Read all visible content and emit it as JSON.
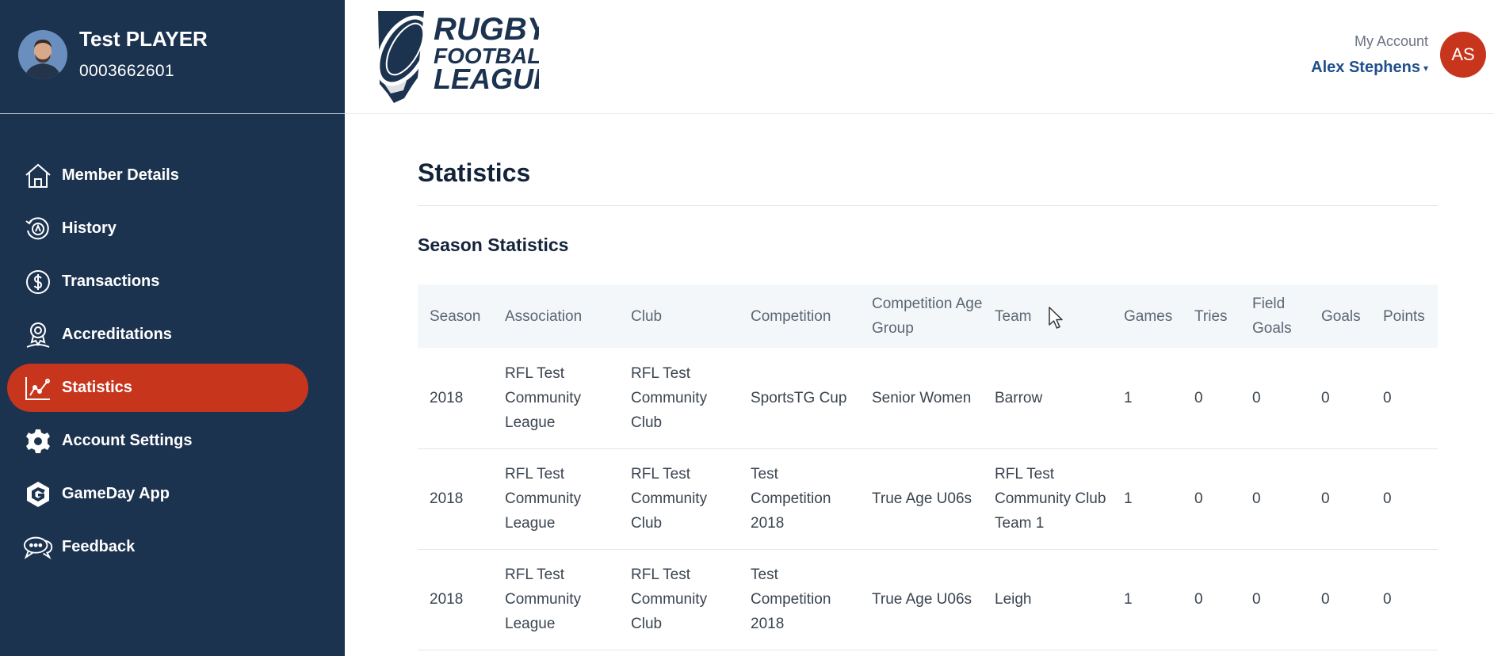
{
  "profile": {
    "name": "Test PLAYER",
    "member_id": "0003662601"
  },
  "nav": {
    "items": [
      {
        "label": "Member Details",
        "icon": "home-icon"
      },
      {
        "label": "History",
        "icon": "history-icon"
      },
      {
        "label": "Transactions",
        "icon": "dollar-icon"
      },
      {
        "label": "Accreditations",
        "icon": "accreditation-icon"
      },
      {
        "label": "Statistics",
        "icon": "chart-icon",
        "active": true
      },
      {
        "label": "Account Settings",
        "icon": "gear-icon"
      },
      {
        "label": "GameDay App",
        "icon": "gameday-icon"
      },
      {
        "label": "Feedback",
        "icon": "feedback-icon"
      }
    ]
  },
  "header": {
    "logo_text": [
      "RUGBY",
      "FOOTBALL",
      "LEAGUE"
    ],
    "account_label": "My Account",
    "account_user": "Alex Stephens",
    "account_initials": "AS"
  },
  "main": {
    "title": "Statistics",
    "section_title": "Season Statistics",
    "table": {
      "headers": [
        "Season",
        "Association",
        "Club",
        "Competition",
        "Competition Age Group",
        "Team",
        "Games",
        "Tries",
        "Field Goals",
        "Goals",
        "Points"
      ],
      "rows": [
        [
          "2018",
          "RFL Test Community League",
          "RFL Test Community Club",
          "SportsTG Cup",
          "Senior Women",
          "Barrow",
          "1",
          "0",
          "0",
          "0",
          "0"
        ],
        [
          "2018",
          "RFL Test Community League",
          "RFL Test Community Club",
          "Test Competition 2018",
          "True Age U06s",
          "RFL Test Community Club Team 1",
          "1",
          "0",
          "0",
          "0",
          "0"
        ],
        [
          "2018",
          "RFL Test Community League",
          "RFL Test Community Club",
          "Test Competition 2018",
          "True Age U06s",
          "Leigh",
          "1",
          "0",
          "0",
          "0",
          "0"
        ]
      ]
    }
  },
  "colors": {
    "sidebar": "#1c3350",
    "accent": "#c8351d",
    "link": "#1f4f8c"
  }
}
